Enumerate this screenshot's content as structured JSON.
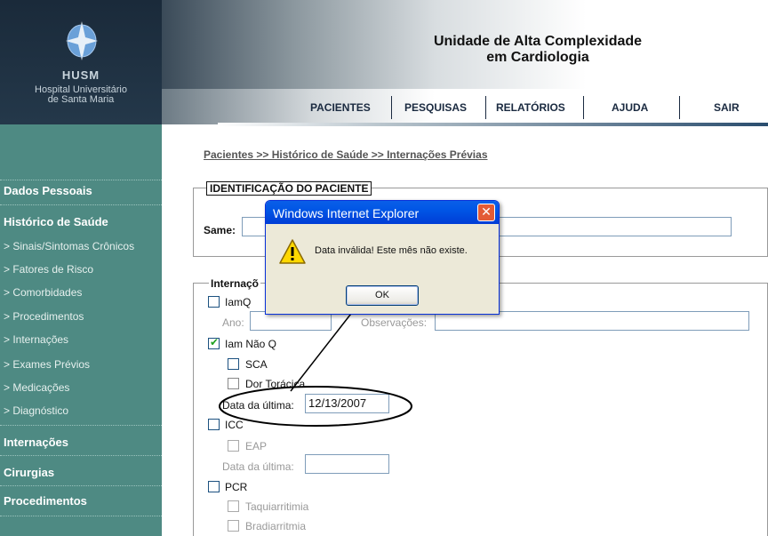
{
  "logo": {
    "short_name": "HUSM",
    "full_name_line1": "Hospital Universitário",
    "full_name_line2": "de Santa Maria"
  },
  "header": {
    "title_line1": "Unidade de Alta Complexidade",
    "title_line2": "em Cardiologia"
  },
  "nav": [
    "PACIENTES",
    "PESQUISAS",
    "RELATÓRIOS",
    "AJUDA",
    "SAIR"
  ],
  "sidebar": {
    "dados": "Dados Pessoais",
    "historico": "Histórico de Saúde",
    "sub": [
      "> Sinais/Sintomas Crônicos",
      "> Fatores de Risco",
      "> Comorbidades",
      "> Procedimentos",
      "> Internações",
      "> Exames Prévios",
      "> Medicações",
      "> Diagnóstico"
    ],
    "internacoes": "Internações",
    "cirurgias": "Cirurgias",
    "procedimentos": "Procedimentos"
  },
  "breadcrumb": "Pacientes >> Histórico de Saúde >> Internações Prévias",
  "ident": {
    "legend": "IDENTIFICAÇÃO DO PACIENTE",
    "same_label": "Same:"
  },
  "intern": {
    "legend": "Internaçõ",
    "iamq": "IamQ",
    "ano_label": "Ano:",
    "obs_label": "Observações:",
    "iam_nao_q": "Iam Não Q",
    "sca": "SCA",
    "dor_toracica": "Dor Torácica",
    "data_ultima_1": "Data da última:",
    "data_value": "12/13/2007",
    "icc": "ICC",
    "eap": "EAP",
    "data_ultima_2": "Data da última:",
    "pcr": "PCR",
    "taqui": "Taquiarritimia",
    "bradi": "Bradiarritmia"
  },
  "dialog": {
    "title": "Windows Internet Explorer",
    "message": "Data inválida! Este mês não existe.",
    "ok": "OK",
    "close_glyph": "✕"
  }
}
